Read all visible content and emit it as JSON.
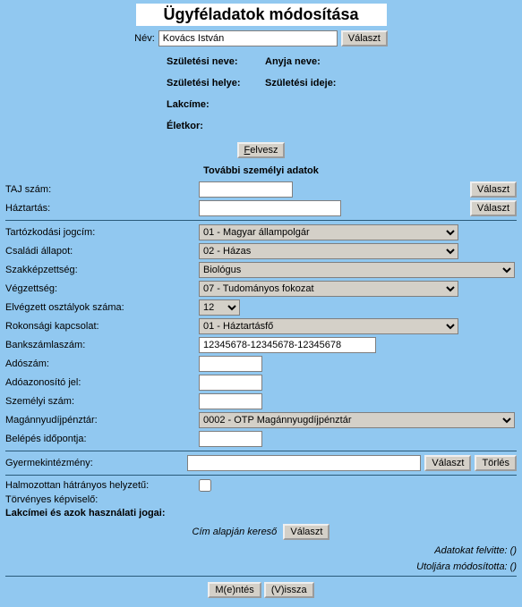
{
  "title": "Ügyféladatok módosítása",
  "name_label": "Név:",
  "name_value": "Kovács István",
  "btn_valaszt": "Választ",
  "btn_torles": "Törlés",
  "btn_felvesz": "Felvesz",
  "personal": {
    "szul_neve": "Születési neve:",
    "anyja_neve": "Anyja neve:",
    "szul_helye": "Születési helye:",
    "szul_ideje": "Születési ideje:",
    "lakcime": "Lakcíme:",
    "eletkor": "Életkor:"
  },
  "section_more": "További személyi adatok",
  "fields": {
    "taj": "TAJ szám:",
    "haztartas": "Háztartás:",
    "tartozkodasi": "Tartózkodási jogcím:",
    "tartozkodasi_val": "01 - Magyar állampolgár",
    "csaladi": "Családi állapot:",
    "csaladi_val": "02 - Házas",
    "szakkepzettseg": "Szakképzettség:",
    "szakkepzettseg_val": "Biológus",
    "vegzettseg": "Végzettség:",
    "vegzettseg_val": "07 - Tudományos fokozat",
    "elvegzett": "Elvégzett osztályok száma:",
    "elvegzett_val": "12",
    "rokonsagi": "Rokonsági kapcsolat:",
    "rokonsagi_val": "01 - Háztartásfő",
    "bankszamla": "Bankszámlaszám:",
    "bankszamla_val": "12345678-12345678-12345678",
    "adoszam": "Adószám:",
    "adoazonosito": "Adóazonosító jel:",
    "szemelyi": "Személyi szám:",
    "magannyugdij": "Magánnyudíjpénztár:",
    "magannyugdij_val": "0002 - OTP Magánnyugdíjpénztár",
    "belepes": "Belépés időpontja:",
    "gyermek": "Gyermekintézmény:",
    "halmozottan": "Halmozottan hátrányos helyzetű:",
    "torvenyes": "Törvényes képviselő:",
    "lakcimek": "Lakcímei és azok használati jogai:"
  },
  "search_label": "Cím alapján kereső",
  "meta_felvitte": "Adatokat felvitte: ()",
  "meta_modositotta": "Utoljára módosította: ()",
  "btn_mentes": "M(e)ntés",
  "btn_vissza": "(V)issza"
}
